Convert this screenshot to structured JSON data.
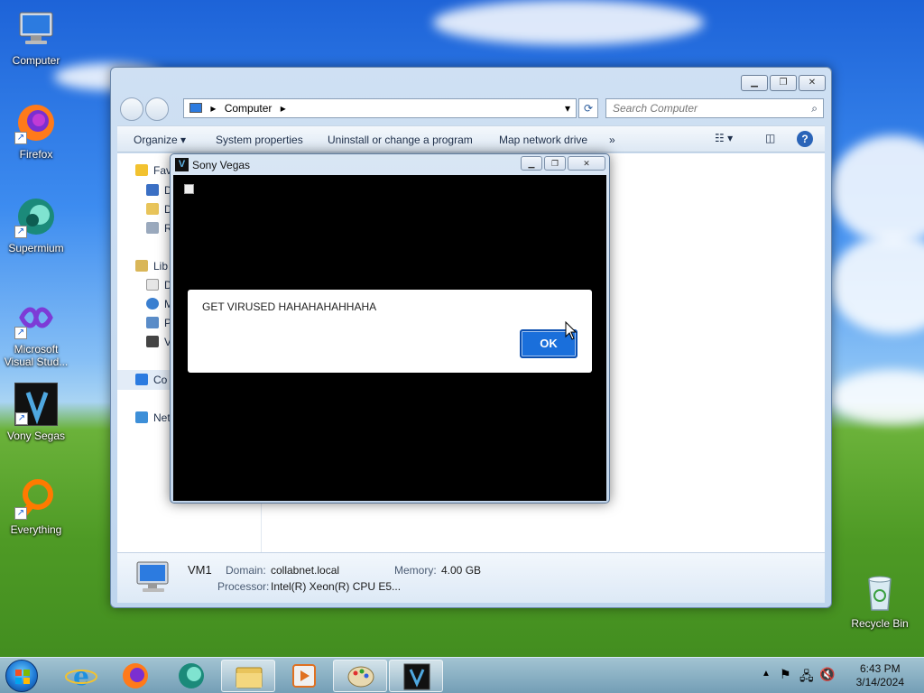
{
  "desktop": {
    "icons": [
      {
        "label": "Computer"
      },
      {
        "label": "Firefox"
      },
      {
        "label": "Supermium"
      },
      {
        "label": "Microsoft Visual Stud..."
      },
      {
        "label": "Vony Segas"
      },
      {
        "label": "Everything"
      },
      {
        "label": "Recycle Bin"
      }
    ]
  },
  "explorer": {
    "address": "Computer",
    "search_placeholder": "Search Computer",
    "toolbar": {
      "organize": "Organize",
      "system_properties": "System properties",
      "uninstall": "Uninstall or change a program",
      "map_drive": "Map network drive",
      "more": "»"
    },
    "nav": {
      "favorites": "Fav",
      "fav_items": [
        "D",
        "D",
        "R"
      ],
      "libraries": "Lib",
      "lib_items": [
        "D",
        "M",
        "P",
        "V"
      ],
      "computer": "Co",
      "network": "Net"
    },
    "details": {
      "name": "VM1",
      "domain_label": "Domain:",
      "domain_value": "collabnet.local",
      "memory_label": "Memory:",
      "memory_value": "4.00 GB",
      "processor_label": "Processor:",
      "processor_value": "Intel(R) Xeon(R) CPU E5..."
    }
  },
  "vegas": {
    "title": "Sony Vegas",
    "logo": "V"
  },
  "dialog": {
    "message": "GET VIRUSED HAHAHAHAHHAHA",
    "ok_label": "OK"
  },
  "taskbar": {
    "time": "6:43 PM",
    "date": "3/14/2024"
  },
  "colors": {
    "ok_button": "#1a6fdb",
    "vegas_body": "#000000"
  }
}
